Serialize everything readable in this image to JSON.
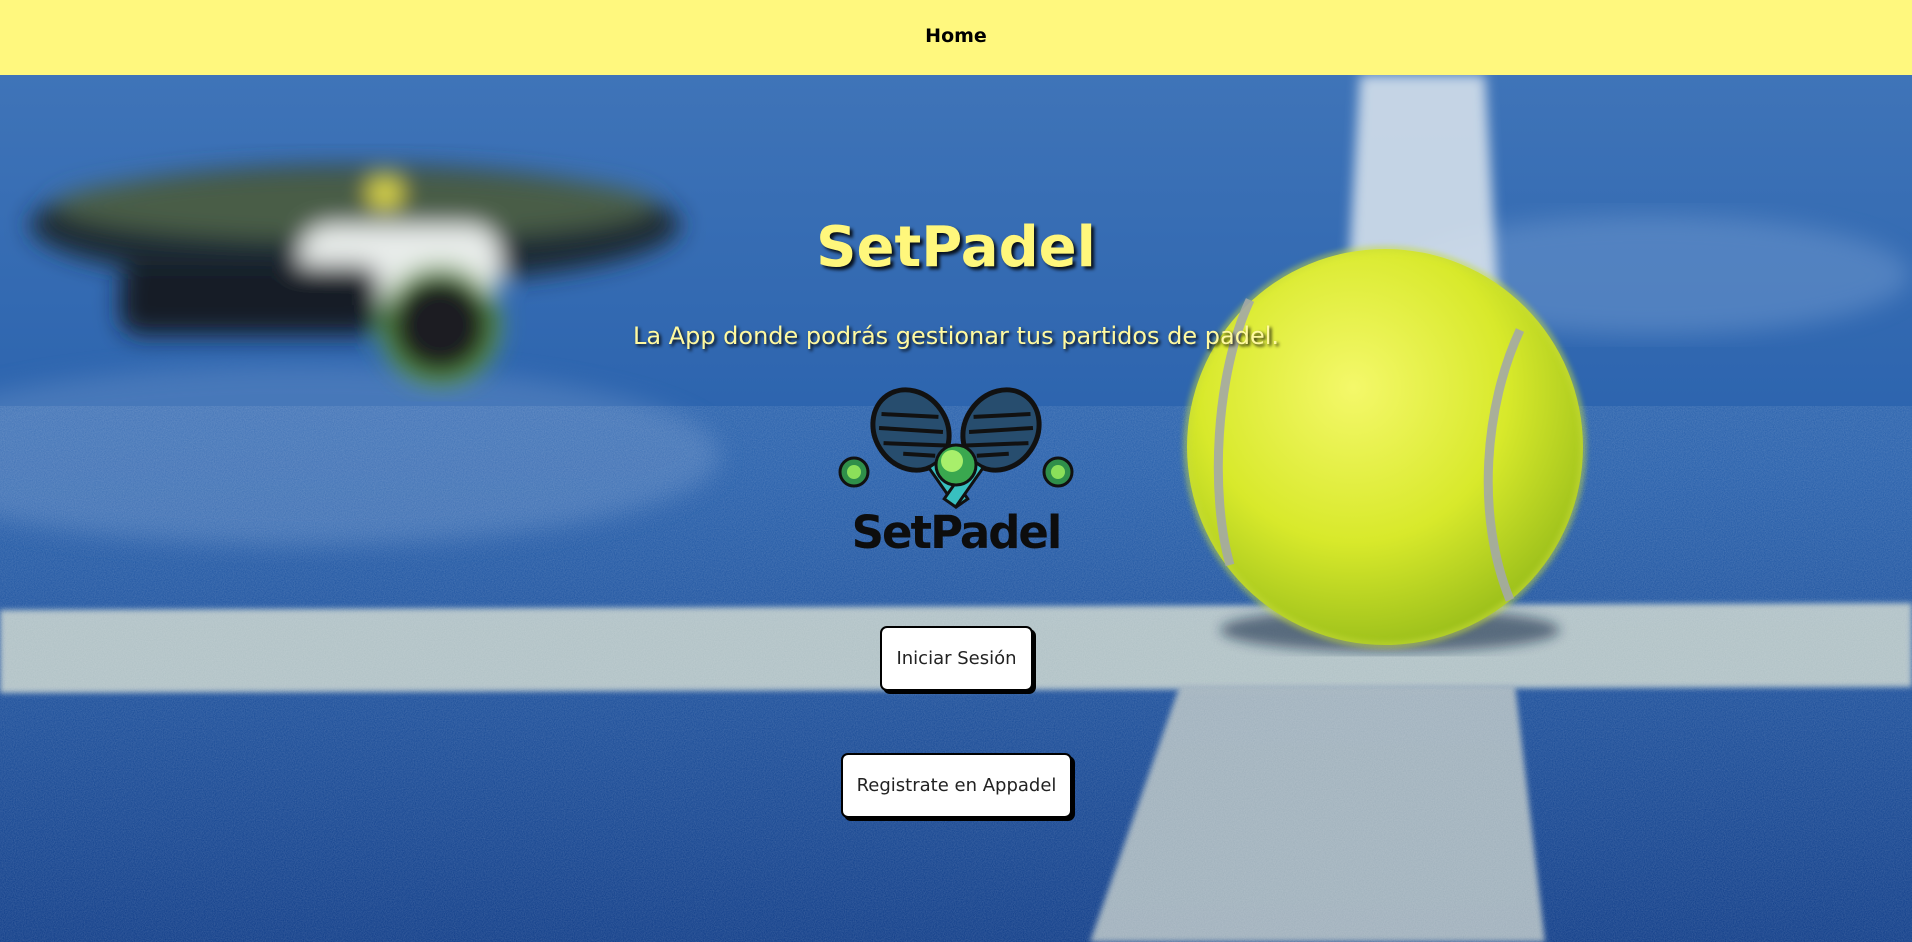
{
  "nav": {
    "home_label": "Home"
  },
  "hero": {
    "title": "SetPadel",
    "tagline": "La App donde podrás gestionar tus partidos de padel.",
    "logo_text": "SetPadel"
  },
  "actions": {
    "login_label": "Iniciar Sesión",
    "register_label": "Registrate en Appadel"
  },
  "colors": {
    "navbar_bg": "#fff87e",
    "title_color": "#fff77c",
    "court_blue": "#1f4f99",
    "ball_yellow": "#dfee2a"
  },
  "icons": {
    "logo": "crossed-rackets-with-ball-icon"
  }
}
